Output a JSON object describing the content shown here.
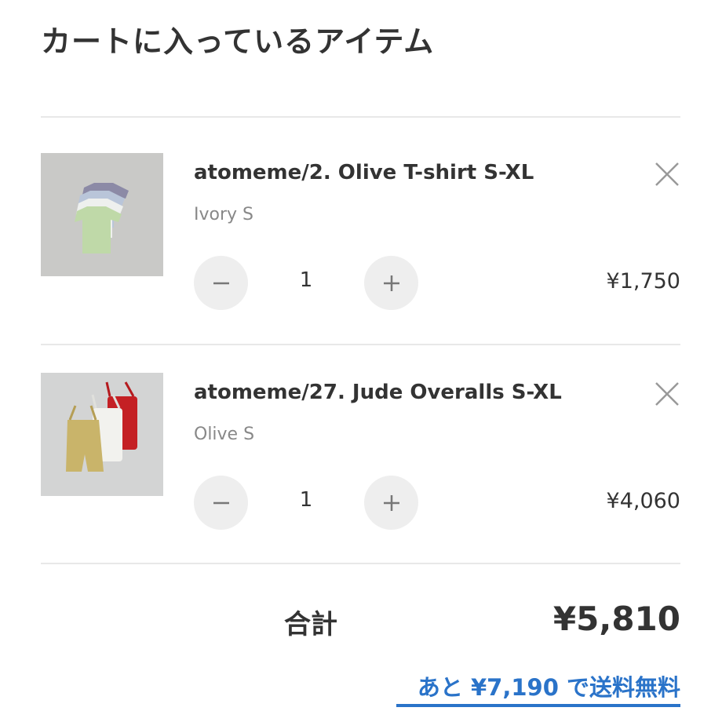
{
  "page": {
    "title": "カートに入っているアイテム"
  },
  "cart": {
    "items": [
      {
        "name": "atomeme/2. Olive T-shirt S-XL",
        "variant": "Ivory S",
        "quantity": "1",
        "price": "¥1,750"
      },
      {
        "name": "atomeme/27. Jude Overalls S-XL",
        "variant": "Olive S",
        "quantity": "1",
        "price": "¥4,060"
      }
    ]
  },
  "summary": {
    "total_label": "合計",
    "total_value": "¥5,810",
    "free_shipping_message": "あと ¥7,190 で送料無料"
  },
  "icons": {
    "remove": "close-icon",
    "decrease": "minus-icon",
    "increase": "plus-icon"
  },
  "colors": {
    "link": "#2a73c9",
    "button_bg": "#eeeeee",
    "divider": "#e8e8e8"
  }
}
